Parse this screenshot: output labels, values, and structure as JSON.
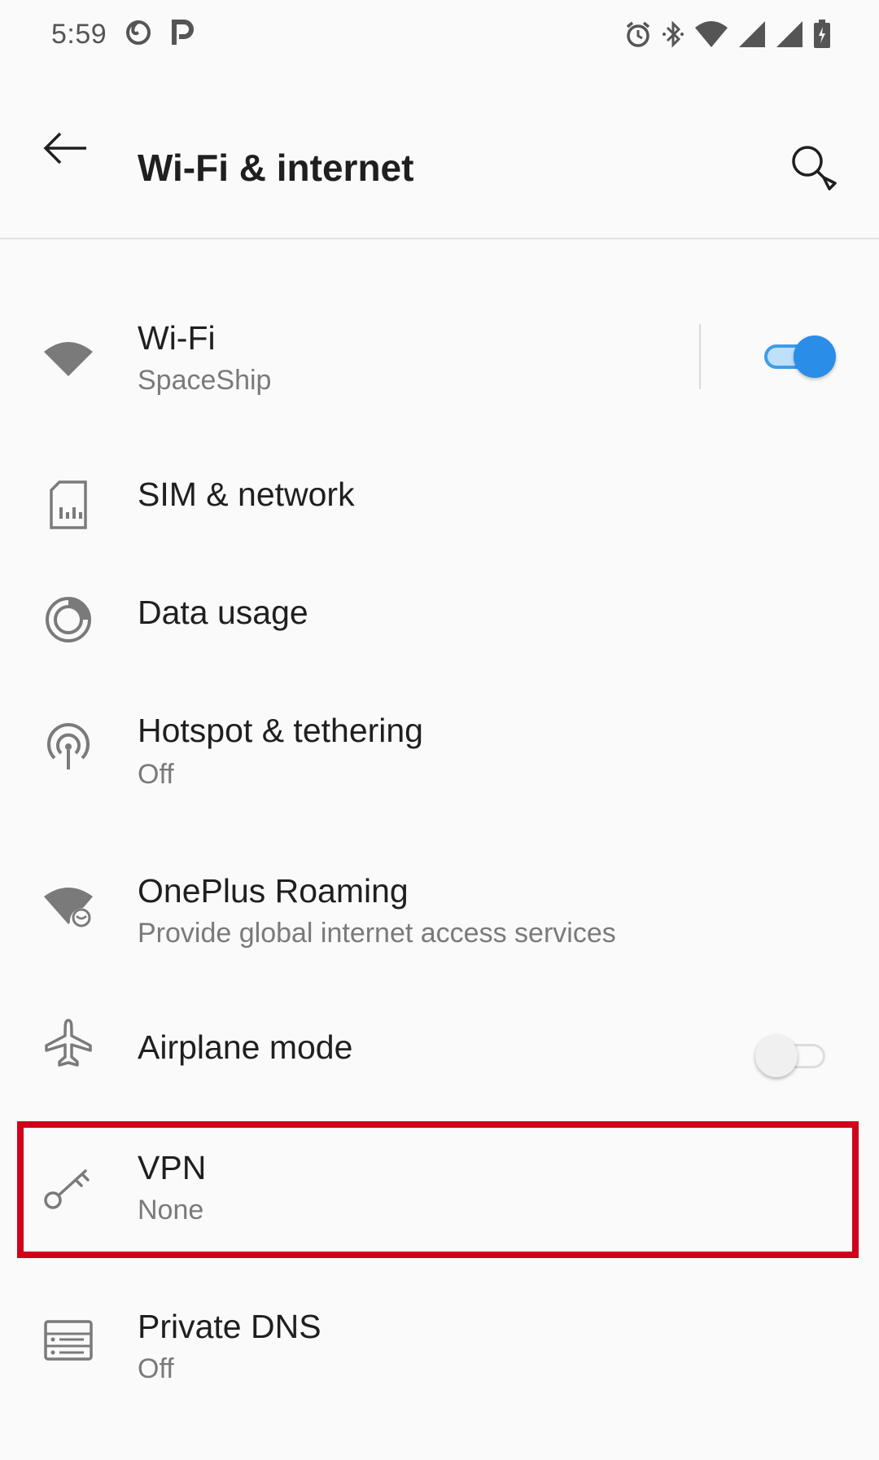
{
  "status_bar": {
    "time": "5:59"
  },
  "header": {
    "title": "Wi-Fi & internet",
    "back_icon": "arrow-back-icon",
    "search_icon": "search-icon"
  },
  "items": [
    {
      "title": "Wi-Fi",
      "summary": "SpaceShip",
      "icon": "wifi-icon",
      "toggle": true
    },
    {
      "title": "SIM & network",
      "summary": "",
      "icon": "sim-card-icon"
    },
    {
      "title": "Data usage",
      "summary": "",
      "icon": "data-usage-icon"
    },
    {
      "title": "Hotspot & tethering",
      "summary": "Off",
      "icon": "hotspot-icon"
    },
    {
      "title": "OnePlus Roaming",
      "summary": "Provide global internet access services",
      "icon": "roaming-icon"
    },
    {
      "title": "Airplane mode",
      "summary": "",
      "icon": "airplane-icon",
      "toggle": false
    },
    {
      "title": "VPN",
      "summary": "None",
      "icon": "vpn-key-icon"
    },
    {
      "title": "Private DNS",
      "summary": "Off",
      "icon": "dns-icon"
    }
  ],
  "colors": {
    "accent": "#2a8de8",
    "highlight": "#d0021b",
    "secondary_text": "#7a7a7a"
  }
}
